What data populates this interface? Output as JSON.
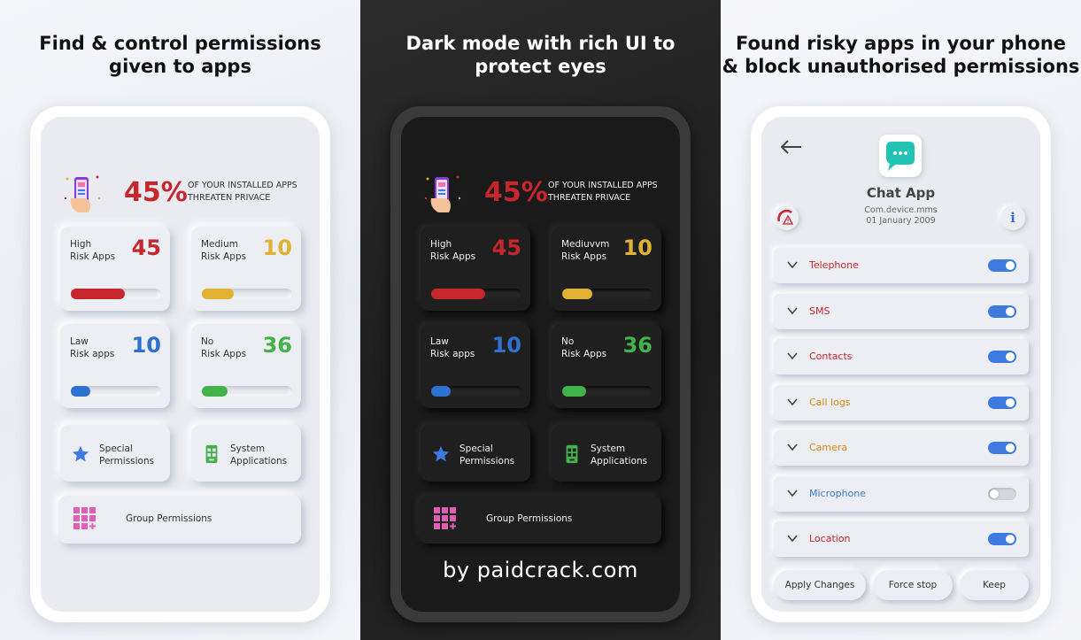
{
  "colors": {
    "high": "#c8262d",
    "medium": "#e2b134",
    "low": "#2f71cf",
    "no_risk": "#43b24a",
    "toggle_on": "#3f7ae0"
  },
  "panel_light": {
    "headline": "Find & control permissions\ngiven to apps",
    "summary": {
      "percent": "45%",
      "text": "OF YOUR INSTALLED APPS\nTHREATEN PRIVACE"
    },
    "cards": [
      {
        "label": "High\nRisk Apps",
        "count": "45",
        "level": 0.6
      },
      {
        "label": "Medium\nRisk Apps",
        "count": "10",
        "level": 0.35
      },
      {
        "label": "Law\nRisk apps",
        "count": "10",
        "level": 0.22
      },
      {
        "label": "No\nRisk Apps",
        "count": "36",
        "level": 0.28
      }
    ],
    "special": "Special\nPermissions",
    "system": "System\nApplications",
    "group": "Group Permissions"
  },
  "panel_dark": {
    "headline": "Dark mode with rich UI to\nprotect eyes",
    "summary": {
      "percent": "45%",
      "text": "OF YOUR INSTALLED APPS\nTHREATEN PRIVACE"
    },
    "cards": [
      {
        "label": "High\nRisk Apps",
        "count": "45",
        "level": 0.6
      },
      {
        "label": "Mediuvvm\nRisk Apps",
        "count": "10",
        "level": 0.33
      },
      {
        "label": "Law\nRisk apps",
        "count": "10",
        "level": 0.22
      },
      {
        "label": "No\nRisk Apps",
        "count": "36",
        "level": 0.26
      }
    ],
    "special": "Special\nPermissions",
    "system": "System\nApplications",
    "group": "Group Permissions",
    "watermark": "by paidcrack.com"
  },
  "panel_app": {
    "headline": "Found risky apps in your phone\n& block unauthorised permissions",
    "app_name": "Chat App",
    "package_and_date": "Com.device.mms\n01 January 2009",
    "info_glyph": "i",
    "permissions": [
      {
        "name": "Telephone",
        "color": "#c8262d",
        "enabled": true
      },
      {
        "name": "SMS",
        "color": "#c8262d",
        "enabled": true
      },
      {
        "name": "Contacts",
        "color": "#c8262d",
        "enabled": true
      },
      {
        "name": "Call logs",
        "color": "#d38a0e",
        "enabled": true
      },
      {
        "name": "Camera",
        "color": "#d38a0e",
        "enabled": true
      },
      {
        "name": "Microphone",
        "color": "#3a7bd5",
        "enabled": false
      },
      {
        "name": "Location",
        "color": "#c8262d",
        "enabled": true
      }
    ],
    "buttons": {
      "apply": "Apply Changes",
      "force_stop": "Force stop",
      "keep": "Keep"
    }
  }
}
